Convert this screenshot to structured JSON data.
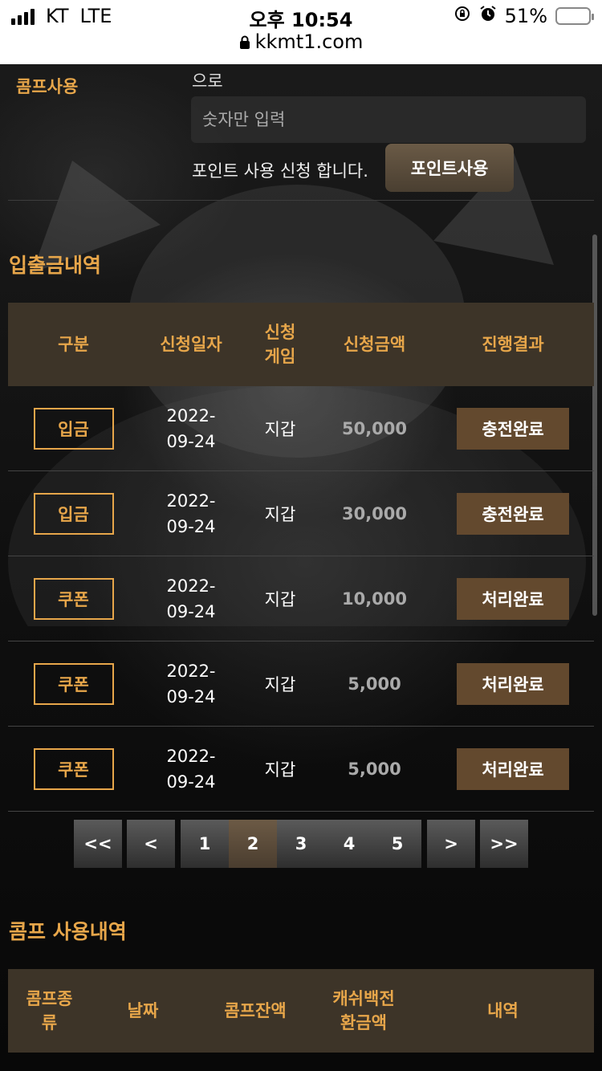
{
  "status_bar": {
    "carrier": "KT",
    "network": "LTE",
    "time": "오후 10:54",
    "url": "kkmt1.com",
    "battery": "51%",
    "battery_level": 0.51
  },
  "comp_use": {
    "label": "콤프사용",
    "suffix": "으로",
    "input_placeholder": "숫자만 입력",
    "note": "포인트 사용 신청 합니다.",
    "button_label": "포인트사용"
  },
  "deposit_history": {
    "title": "입출금내역",
    "headers": [
      "구분",
      "신청일자",
      "신청\n게임",
      "신청금액",
      "진행결과"
    ],
    "rows": [
      {
        "type": "입금",
        "date_line1": "2022-",
        "date_line2": "09-24",
        "game": "지갑",
        "amount": "50,000",
        "status": "충전완료"
      },
      {
        "type": "입금",
        "date_line1": "2022-",
        "date_line2": "09-24",
        "game": "지갑",
        "amount": "30,000",
        "status": "충전완료"
      },
      {
        "type": "쿠폰",
        "date_line1": "2022-",
        "date_line2": "09-24",
        "game": "지갑",
        "amount": "10,000",
        "status": "처리완료"
      },
      {
        "type": "쿠폰",
        "date_line1": "2022-",
        "date_line2": "09-24",
        "game": "지갑",
        "amount": "5,000",
        "status": "처리완료"
      },
      {
        "type": "쿠폰",
        "date_line1": "2022-",
        "date_line2": "09-24",
        "game": "지갑",
        "amount": "5,000",
        "status": "처리완료"
      }
    ]
  },
  "pagination": {
    "first": "<<",
    "prev": "<",
    "pages": [
      "1",
      "2",
      "3",
      "4",
      "5"
    ],
    "current": "2",
    "next": ">",
    "last": ">>"
  },
  "comp_history": {
    "title": "콤프 사용내역",
    "headers": [
      "콤프종\n류",
      "날짜",
      "콤프잔액",
      "캐쉬백전\n환금액",
      "내역"
    ]
  },
  "colors": {
    "accent": "#e7a64a",
    "header_bg": "#3d3428",
    "badge_bg": "#63492e"
  }
}
